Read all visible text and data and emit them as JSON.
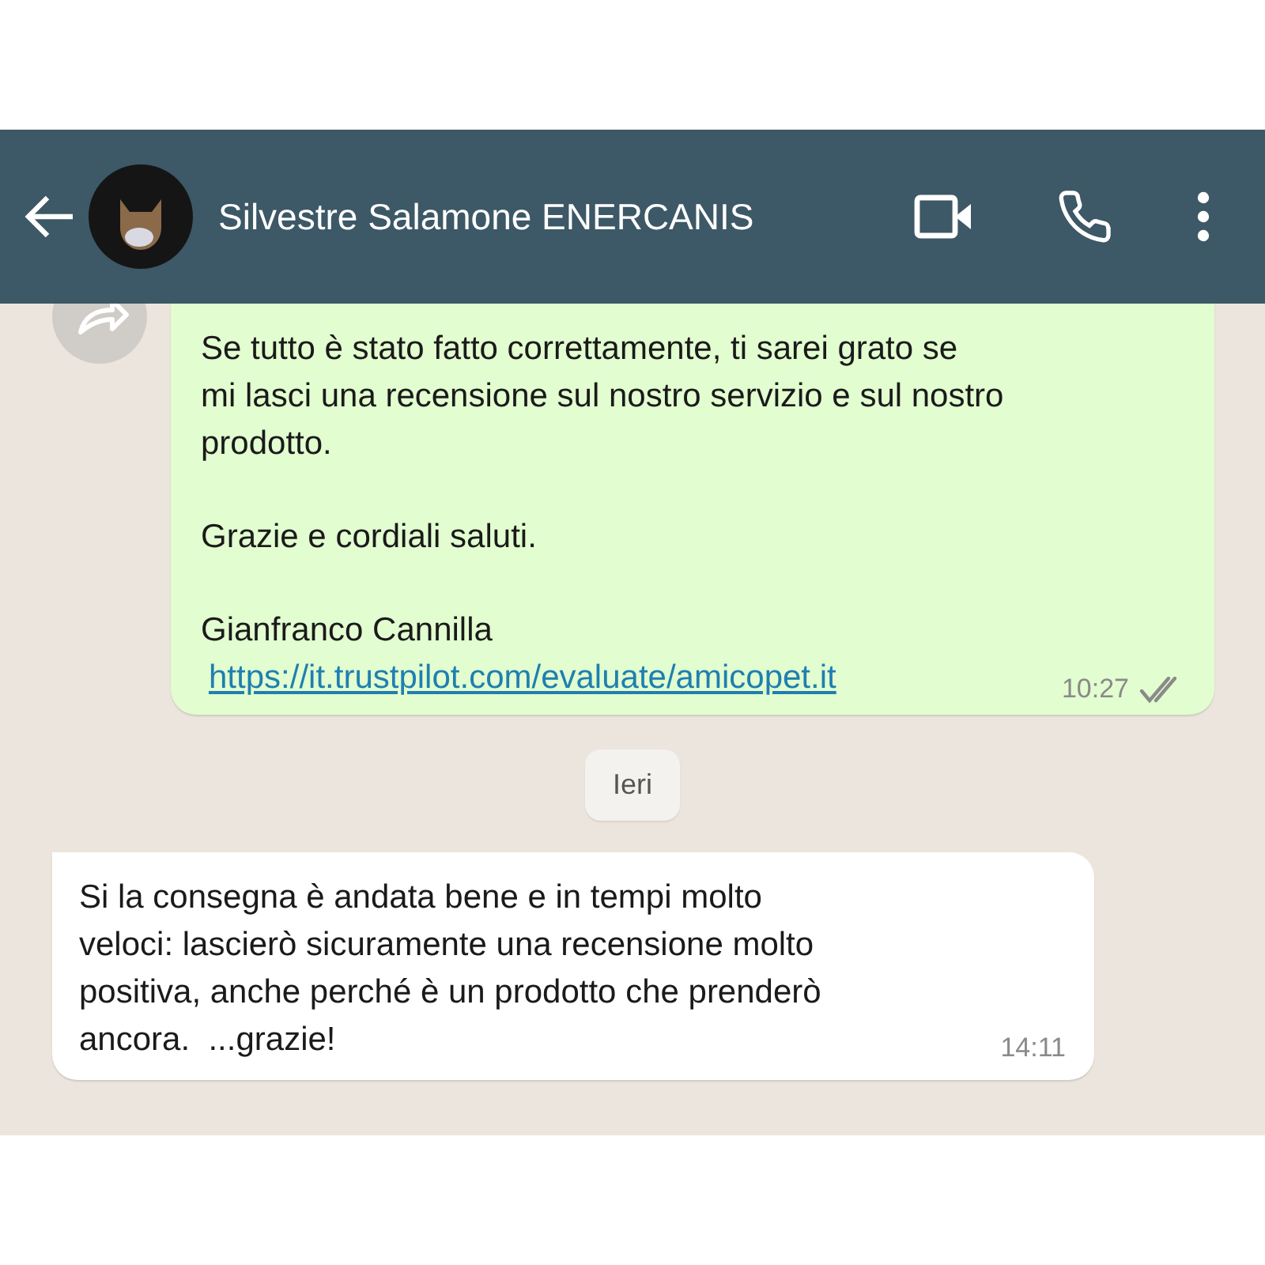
{
  "header": {
    "contact_name": "Silvestre Salamone ENERCANIS"
  },
  "messages": [
    {
      "kind": "outgoing",
      "forwarded": true,
      "paragraphs": [
        [
          "Se tutto è stato fatto correttamente, ti sarei grato se",
          "mi lasci una recensione sul nostro servizio e sul nostro",
          "prodotto."
        ],
        [
          "Grazie e cordiali saluti."
        ],
        [
          "Gianfranco Cannilla"
        ]
      ],
      "link": "https://it.trustpilot.com/evaluate/amicopet.it",
      "time": "10:27",
      "read": true
    },
    {
      "kind": "date",
      "label": "Ieri"
    },
    {
      "kind": "incoming",
      "paragraphs": [
        [
          "Si la consegna è andata bene e in tempi molto",
          "veloci: lascierò sicuramente una recensione molto",
          "positiva, anche perché è un prodotto che prenderò",
          "ancora.  ...grazie!"
        ]
      ],
      "time": "14:11"
    }
  ]
}
